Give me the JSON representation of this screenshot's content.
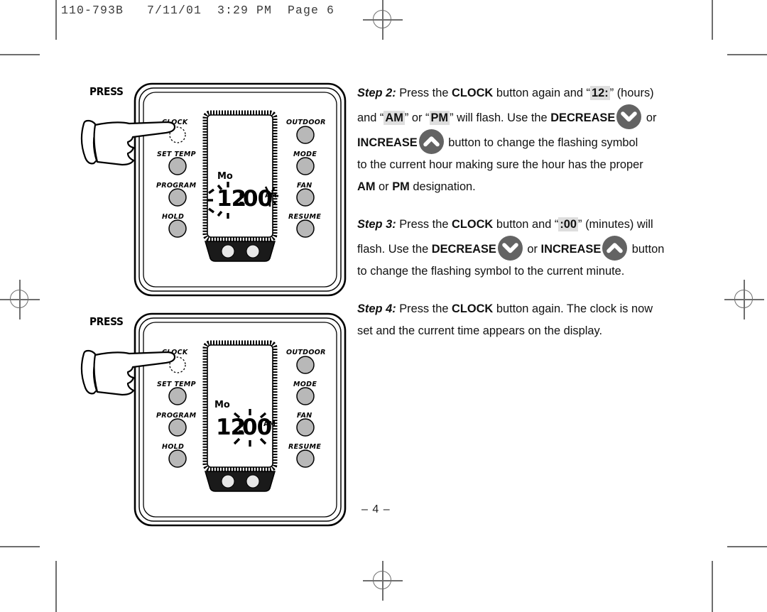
{
  "page": {
    "slug": "110-793B   7/11/01  3:29 PM  Page 6",
    "page_number": "– 4 –",
    "accent_gray": "#636363",
    "highlight_gray": "#dedede"
  },
  "steps": [
    {
      "label": "Step 2:",
      "lines": [
        [
          {
            "t": "label",
            "v": "Step 2:"
          },
          {
            "t": "plain",
            "v": " Press the "
          },
          {
            "t": "bold",
            "v": "CLOCK"
          },
          {
            "t": "plain",
            "v": " button again and "
          },
          {
            "t": "quote",
            "v": "“"
          },
          {
            "t": "hl",
            "v": "12:"
          },
          {
            "t": "quote",
            "v": "”"
          },
          {
            "t": "plain",
            "v": " (hours)"
          }
        ],
        [
          {
            "t": "plain",
            "v": "and "
          },
          {
            "t": "quote",
            "v": "“"
          },
          {
            "t": "hl",
            "v": "AM"
          },
          {
            "t": "quote",
            "v": "”"
          },
          {
            "t": "plain",
            "v": " or "
          },
          {
            "t": "quote",
            "v": "“"
          },
          {
            "t": "hl",
            "v": "PM"
          },
          {
            "t": "quote",
            "v": "”"
          },
          {
            "t": "plain",
            "v": " will flash. Use the "
          },
          {
            "t": "bold",
            "v": "DECREASE"
          },
          {
            "t": "icon",
            "v": "chevron-down-icon"
          },
          {
            "t": "plain",
            "v": " or"
          }
        ],
        [
          {
            "t": "bold",
            "v": "INCREASE"
          },
          {
            "t": "icon",
            "v": "chevron-up-icon"
          },
          {
            "t": "plain",
            "v": " button to change the flashing symbol"
          }
        ],
        [
          {
            "t": "plain",
            "v": "to the current hour making sure the hour has the proper"
          }
        ],
        [
          {
            "t": "bold",
            "v": "AM"
          },
          {
            "t": "plain",
            "v": " or "
          },
          {
            "t": "bold",
            "v": "PM"
          },
          {
            "t": "plain",
            "v": " designation."
          }
        ]
      ]
    },
    {
      "label": "Step 3:",
      "lines": [
        [
          {
            "t": "label",
            "v": "Step 3:"
          },
          {
            "t": "plain",
            "v": " Press the "
          },
          {
            "t": "bold",
            "v": "CLOCK"
          },
          {
            "t": "plain",
            "v": " button and "
          },
          {
            "t": "quote",
            "v": "“"
          },
          {
            "t": "hl",
            "v": ":00"
          },
          {
            "t": "quote",
            "v": "”"
          },
          {
            "t": "plain",
            "v": " (minutes) will"
          }
        ],
        [
          {
            "t": "plain",
            "v": "flash. Use the "
          },
          {
            "t": "bold",
            "v": "DECREASE"
          },
          {
            "t": "icon",
            "v": "chevron-down-icon"
          },
          {
            "t": "plain",
            "v": " or "
          },
          {
            "t": "bold",
            "v": "INCREASE"
          },
          {
            "t": "icon",
            "v": "chevron-up-icon"
          },
          {
            "t": "plain",
            "v": " button"
          }
        ],
        [
          {
            "t": "plain",
            "v": "to change the flashing symbol to the current minute."
          }
        ]
      ]
    },
    {
      "label": "Step 4:",
      "lines": [
        [
          {
            "t": "label",
            "v": "Step 4:"
          },
          {
            "t": "plain",
            "v": " Press the "
          },
          {
            "t": "bold",
            "v": "CLOCK"
          },
          {
            "t": "plain",
            "v": " button again. The clock is now"
          }
        ],
        [
          {
            "t": "plain",
            "v": "set and the current time appears on the display."
          }
        ]
      ]
    }
  ],
  "figures": [
    {
      "id": "figure-step2",
      "press_label": "PRESS",
      "left_buttons": [
        "CLOCK",
        "SET TEMP",
        "PROGRAM",
        "HOLD"
      ],
      "right_buttons": [
        "OUTDOOR",
        "MODE",
        "FAN",
        "RESUME"
      ],
      "display": {
        "day": "Mo",
        "hours": "12",
        "colon": ":",
        "minutes": "00",
        "meridiem": "AM",
        "flashing": "hours-and-meridiem"
      },
      "pressed_button": "CLOCK"
    },
    {
      "id": "figure-step3",
      "press_label": "PRESS",
      "left_buttons": [
        "CLOCK",
        "SET TEMP",
        "PROGRAM",
        "HOLD"
      ],
      "right_buttons": [
        "OUTDOOR",
        "MODE",
        "FAN",
        "RESUME"
      ],
      "display": {
        "day": "Mo",
        "hours": "12",
        "colon": ":",
        "minutes": "00",
        "meridiem": "AM",
        "flashing": "minutes"
      },
      "pressed_button": "CLOCK"
    }
  ]
}
